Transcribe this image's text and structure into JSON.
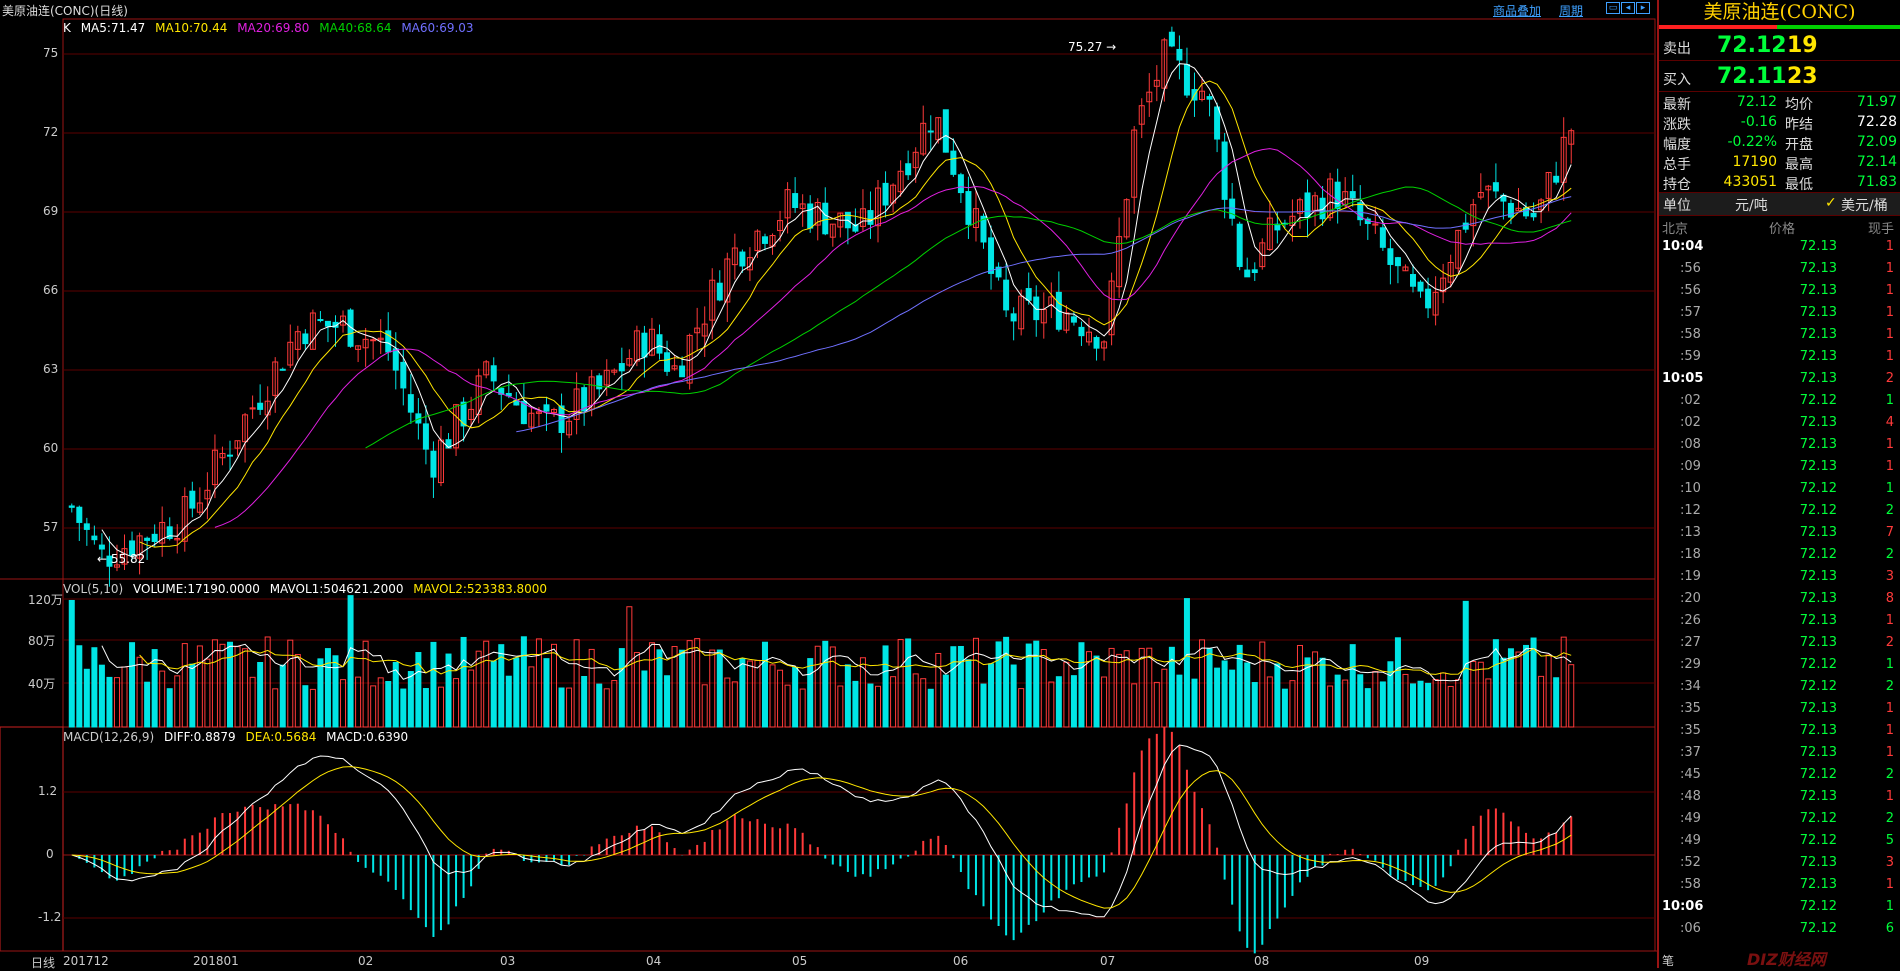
{
  "title_bar": {
    "title": "美原油连(CONC)(日线)",
    "overlay_label": "商品叠加",
    "period_label": "周期"
  },
  "colors": {
    "up": "#ff3a3a",
    "down": "#00e5e5",
    "ma5": "#ffffff",
    "ma10": "#ffe600",
    "ma20": "#e020e0",
    "ma40": "#00d000",
    "ma60": "#7070ff",
    "grid": "#5b0000"
  },
  "main_indicator": {
    "prefix": "K",
    "ma5": "MA5:71.47",
    "ma10": "MA10:70.44",
    "ma20": "MA20:69.80",
    "ma40": "MA40:68.64",
    "ma60": "MA60:69.03"
  },
  "price_axis": [
    "75",
    "72",
    "69",
    "66",
    "63",
    "60",
    "57"
  ],
  "annotations": {
    "high": "75.27",
    "low": "55.82"
  },
  "volume_indicator": {
    "name": "VOL(5,10)",
    "volume": "VOLUME:17190.0000",
    "mavol1": "MAVOL1:504621.2000",
    "mavol2": "MAVOL2:523383.8000"
  },
  "volume_axis": [
    "120万",
    "80万",
    "40万"
  ],
  "macd_indicator": {
    "name": "MACD(12,26,9)",
    "diff": "DIFF:0.8879",
    "dea": "DEA:0.5684",
    "macd": "MACD:0.6390"
  },
  "macd_axis": [
    "1.2",
    "0",
    "-1.2"
  ],
  "x_axis": {
    "period_label": "日线",
    "labels": [
      "201712",
      "201801",
      "02",
      "03",
      "04",
      "05",
      "06",
      "07",
      "08",
      "09"
    ]
  },
  "quote": {
    "title": "美原油连(CONC)",
    "sell_label": "卖出",
    "sell_price": "72.12",
    "sell_vol": "19",
    "buy_label": "买入",
    "buy_price": "72.11",
    "buy_vol": "23",
    "stats": [
      {
        "k": "最新",
        "v": "72.12",
        "c": "#00ff3a",
        "k2": "均价",
        "v2": "71.97",
        "c2": "#00ff3a"
      },
      {
        "k": "涨跌",
        "v": "-0.16",
        "c": "#00ff3a",
        "k2": "昨结",
        "v2": "72.28",
        "c2": "#ffffff"
      },
      {
        "k": "幅度",
        "v": "-0.22%",
        "c": "#00ff3a",
        "k2": "开盘",
        "v2": "72.09",
        "c2": "#00ff3a"
      },
      {
        "k": "总手",
        "v": "17190",
        "c": "#ffe600",
        "k2": "最高",
        "v2": "72.14",
        "c2": "#00ff3a"
      },
      {
        "k": "持仓",
        "v": "433051",
        "c": "#ffe600",
        "k2": "最低",
        "v2": "71.83",
        "c2": "#00ff3a"
      }
    ],
    "unit_label": "单位",
    "unit_opt1": "元/吨",
    "unit_opt2": "美元/桶",
    "ticks_header": {
      "time": "北京",
      "price": "价格",
      "qty": "现手"
    },
    "ticks": [
      {
        "t": "10:04",
        "p": "72.13",
        "q": "1"
      },
      {
        "t": ":56",
        "p": "72.13",
        "q": "1"
      },
      {
        "t": ":56",
        "p": "72.13",
        "q": "1"
      },
      {
        "t": ":57",
        "p": "72.13",
        "q": "1"
      },
      {
        "t": ":58",
        "p": "72.13",
        "q": "1"
      },
      {
        "t": ":59",
        "p": "72.13",
        "q": "1"
      },
      {
        "t": "10:05",
        "p": "72.13",
        "q": "2"
      },
      {
        "t": ":02",
        "p": "72.12",
        "q": "1"
      },
      {
        "t": ":02",
        "p": "72.13",
        "q": "4"
      },
      {
        "t": ":08",
        "p": "72.13",
        "q": "1"
      },
      {
        "t": ":09",
        "p": "72.13",
        "q": "1"
      },
      {
        "t": ":10",
        "p": "72.12",
        "q": "1"
      },
      {
        "t": ":12",
        "p": "72.12",
        "q": "2"
      },
      {
        "t": ":13",
        "p": "72.13",
        "q": "7"
      },
      {
        "t": ":18",
        "p": "72.12",
        "q": "2"
      },
      {
        "t": ":19",
        "p": "72.13",
        "q": "3"
      },
      {
        "t": ":20",
        "p": "72.13",
        "q": "8"
      },
      {
        "t": ":26",
        "p": "72.13",
        "q": "1"
      },
      {
        "t": ":27",
        "p": "72.13",
        "q": "2"
      },
      {
        "t": ":29",
        "p": "72.12",
        "q": "1"
      },
      {
        "t": ":34",
        "p": "72.12",
        "q": "2"
      },
      {
        "t": ":35",
        "p": "72.13",
        "q": "1"
      },
      {
        "t": ":35",
        "p": "72.13",
        "q": "1"
      },
      {
        "t": ":37",
        "p": "72.13",
        "q": "1"
      },
      {
        "t": ":45",
        "p": "72.12",
        "q": "2"
      },
      {
        "t": ":48",
        "p": "72.13",
        "q": "1"
      },
      {
        "t": ":49",
        "p": "72.12",
        "q": "2"
      },
      {
        "t": ":49",
        "p": "72.12",
        "q": "5"
      },
      {
        "t": ":52",
        "p": "72.13",
        "q": "3"
      },
      {
        "t": ":58",
        "p": "72.13",
        "q": "1"
      },
      {
        "t": "10:06",
        "p": "72.12",
        "q": "1"
      },
      {
        "t": ":06",
        "p": "72.12",
        "q": "6"
      }
    ],
    "footer_label": "笔"
  }
}
